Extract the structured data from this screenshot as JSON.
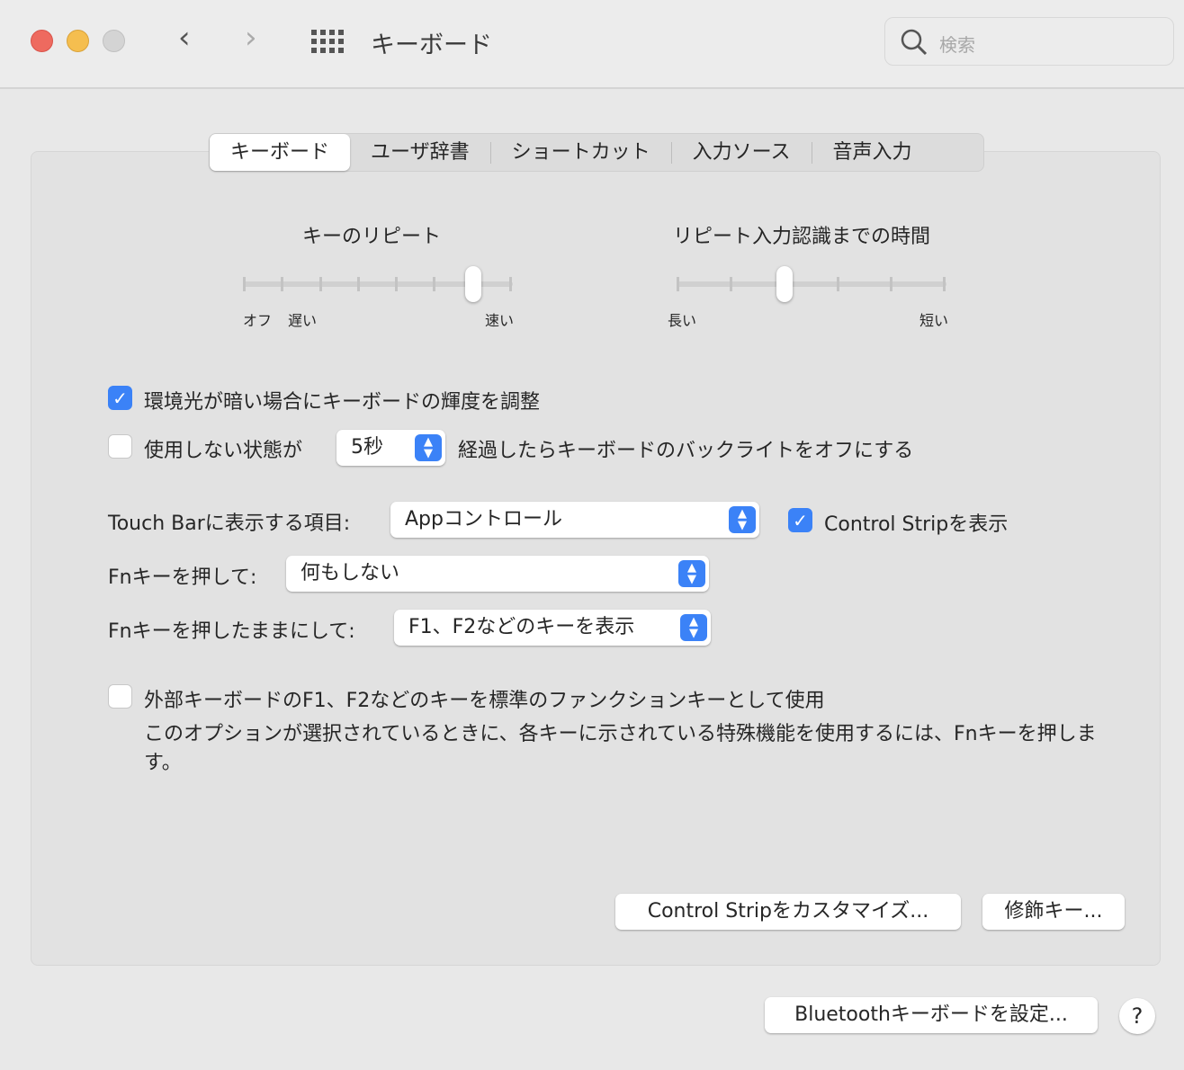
{
  "window": {
    "title": "キーボード",
    "search_placeholder": "検索"
  },
  "tabs": [
    {
      "label": "キーボード",
      "selected": true
    },
    {
      "label": "ユーザ辞書"
    },
    {
      "label": "ショートカット"
    },
    {
      "label": "入力ソース"
    },
    {
      "label": "音声入力"
    }
  ],
  "key_repeat": {
    "title": "キーのリピート",
    "labels": [
      "オフ",
      "遅い",
      "速い"
    ],
    "ticks": 8,
    "value_index": 6
  },
  "repeat_delay": {
    "title": "リピート入力認識までの時間",
    "labels": [
      "長い",
      "短い"
    ],
    "ticks": 6,
    "value_index": 2
  },
  "backlight_adjust": {
    "label": "環境光が暗い場合にキーボードの輝度を調整",
    "checked": true
  },
  "backlight_off": {
    "label_before": "使用しない状態が",
    "value": "5秒",
    "label_after": "経過したらキーボードのバックライトをオフにする",
    "checked": false
  },
  "touchbar": {
    "label": "Touch Barに表示する項目:",
    "value": "Appコントロール",
    "control_strip_label": "Control Stripを表示",
    "control_strip_checked": true
  },
  "fn_press": {
    "label": "Fnキーを押して:",
    "value": "何もしない"
  },
  "fn_hold": {
    "label": "Fnキーを押したままにして:",
    "value": "F1、F2などのキーを表示"
  },
  "fn_standard": {
    "label": "外部キーボードのF1、F2などのキーを標準のファンクションキーとして使用",
    "checked": false,
    "description": "このオプションが選択されているときに、各キーに示されている特殊機能を使用するには、Fnキーを押します。"
  },
  "buttons": {
    "customize": "Control Stripをカスタマイズ...",
    "modifier": "修飾キー...",
    "bluetooth": "Bluetoothキーボードを設定...",
    "help": "?"
  },
  "colors": {
    "accent": "#3b82f7",
    "close": "#ee6a5f",
    "minimize": "#f5be4f",
    "zoom_disabled": "#d4d4d4"
  }
}
